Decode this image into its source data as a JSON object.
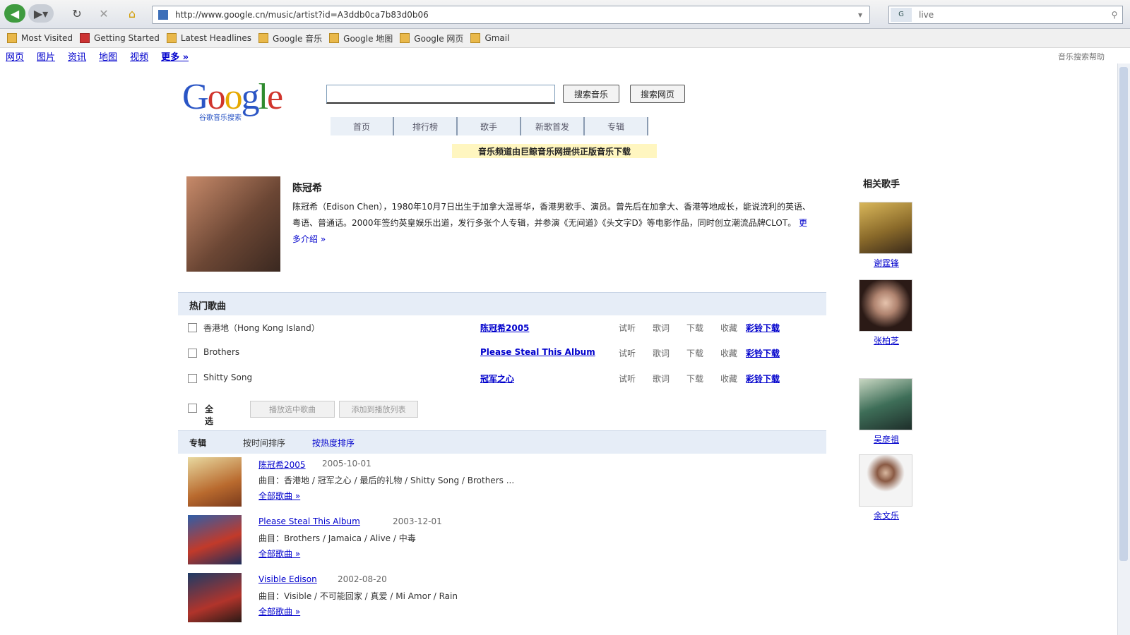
{
  "browser": {
    "url": "http://www.google.cn/music/artist?id=A3ddb0ca7b83d0b06",
    "search_query": "live",
    "search_engine_label": "G"
  },
  "bookmarks": [
    {
      "label": "Most Visited"
    },
    {
      "label": "Getting Started",
      "red": true
    },
    {
      "label": "Latest Headlines"
    },
    {
      "label": "Google 音乐"
    },
    {
      "label": "Google 地图"
    },
    {
      "label": "Google 网页"
    },
    {
      "label": "Gmail"
    }
  ],
  "google_links": {
    "items": [
      {
        "label": "网页"
      },
      {
        "label": "图片"
      },
      {
        "label": "资讯"
      },
      {
        "label": "地图"
      },
      {
        "label": "视频"
      },
      {
        "label": "更多 »",
        "bold": true
      }
    ],
    "right_text": "音乐搜索帮助"
  },
  "header": {
    "logo": "Google",
    "logo_sub": "谷歌音乐搜索",
    "search_button": "搜索音乐",
    "web_button": "搜索网页",
    "tabs": [
      "首页",
      "排行榜",
      "歌手",
      "新歌首发",
      "专辑"
    ],
    "notice": "音乐频道由巨鲸音乐网提供正版音乐下载"
  },
  "artist": {
    "name": "陈冠希",
    "bio": "陈冠希（Edison Chen），1980年10月7日出生于加拿大温哥华，香港男歌手、演员。曾先后在加拿大、香港等地成长，能说流利的英语、粤语、普通话。2000年签约英皇娱乐出道，发行多张个人专辑，并参演《无间道》《头文字D》等电影作品，同时创立潮流品牌CLOT。",
    "more_link": "更多介绍 »"
  },
  "songs_section": {
    "title": "热门歌曲",
    "songs": [
      {
        "name": "香港地（Hong Kong Island）",
        "album": "陈冠希2005",
        "actions": [
          "试听",
          "歌词",
          "下载",
          "收藏"
        ],
        "buy": "彩铃下载"
      },
      {
        "name": "Brothers",
        "album": "Please Steal This Album",
        "actions": [
          "试听",
          "歌词",
          "下载",
          "收藏"
        ],
        "buy": "彩铃下载"
      },
      {
        "name": "Shitty Song",
        "album": "冠军之心",
        "actions": [
          "试听",
          "歌词",
          "下载",
          "收藏"
        ],
        "buy": "彩铃下载"
      }
    ],
    "select_all": "全选",
    "btn_play": "播放选中歌曲",
    "btn_add": "添加到播放列表"
  },
  "albums_section": {
    "tabs": [
      "专辑",
      "按时间排序",
      "按热度排序"
    ],
    "albums": [
      {
        "title": "陈冠希2005",
        "year": "2005-10-01",
        "tracks": "曲目：香港地 / 冠军之心 / 最后的礼物 / Shitty Song / Brothers ...",
        "more": "全部歌曲 »"
      },
      {
        "title": "Please Steal This Album",
        "year": "2003-12-01",
        "tracks": "曲目：Brothers / Jamaica / Alive / 中毒",
        "more": "全部歌曲 »"
      },
      {
        "title": "Visible Edison",
        "year": "2002-08-20",
        "tracks": "曲目：Visible / 不可能回家 / 真爱 / Mi Amor / Rain",
        "more": "全部歌曲 »"
      }
    ]
  },
  "related": {
    "title": "相关歌手",
    "artists": [
      {
        "name": "谢霆锋"
      },
      {
        "name": "张柏芝"
      },
      {
        "name": "吴彦祖"
      },
      {
        "name": "余文乐"
      }
    ]
  }
}
